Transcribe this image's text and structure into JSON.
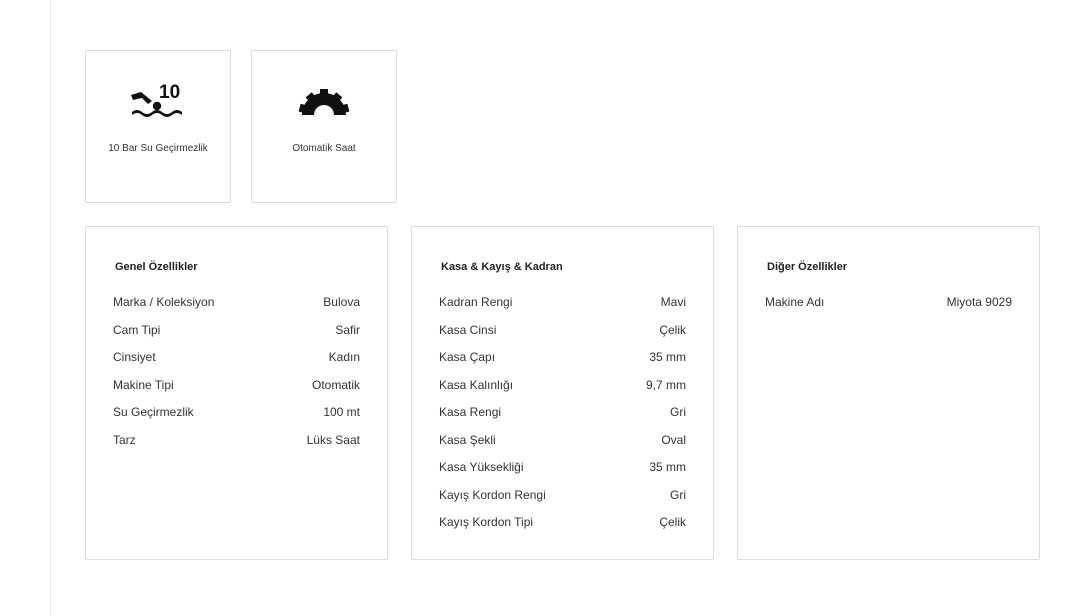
{
  "features": [
    {
      "icon": "swim-10-bar-icon",
      "badge": "10",
      "label": "10 Bar Su Geçirmezlik"
    },
    {
      "icon": "gear-icon",
      "label": "Otomatik Saat"
    }
  ],
  "spec_cards": [
    {
      "title": "Genel Özellikler",
      "rows": [
        {
          "key": "Marka / Koleksiyon",
          "value": "Bulova"
        },
        {
          "key": "Cam Tipi",
          "value": "Safir"
        },
        {
          "key": "Cinsiyet",
          "value": "Kadın"
        },
        {
          "key": "Makine Tipi",
          "value": "Otomatik"
        },
        {
          "key": "Su Geçirmezlik",
          "value": "100 mt"
        },
        {
          "key": "Tarz",
          "value": "Lüks Saat"
        }
      ]
    },
    {
      "title": "Kasa & Kayış & Kadran",
      "rows": [
        {
          "key": "Kadran Rengi",
          "value": "Mavi"
        },
        {
          "key": "Kasa Cinsi",
          "value": "Çelik"
        },
        {
          "key": "Kasa Çapı",
          "value": "35 mm"
        },
        {
          "key": "Kasa Kalınlığı",
          "value": "9,7 mm"
        },
        {
          "key": "Kasa Rengi",
          "value": "Gri"
        },
        {
          "key": "Kasa Şekli",
          "value": "Oval"
        },
        {
          "key": "Kasa Yüksekliği",
          "value": "35 mm"
        },
        {
          "key": "Kayış Kordon Rengi",
          "value": "Gri"
        },
        {
          "key": "Kayış Kordon Tipi",
          "value": "Çelik"
        }
      ]
    },
    {
      "title": "Diğer Özellikler",
      "rows": [
        {
          "key": "Makine Adı",
          "value": "Miyota 9029"
        }
      ]
    }
  ]
}
